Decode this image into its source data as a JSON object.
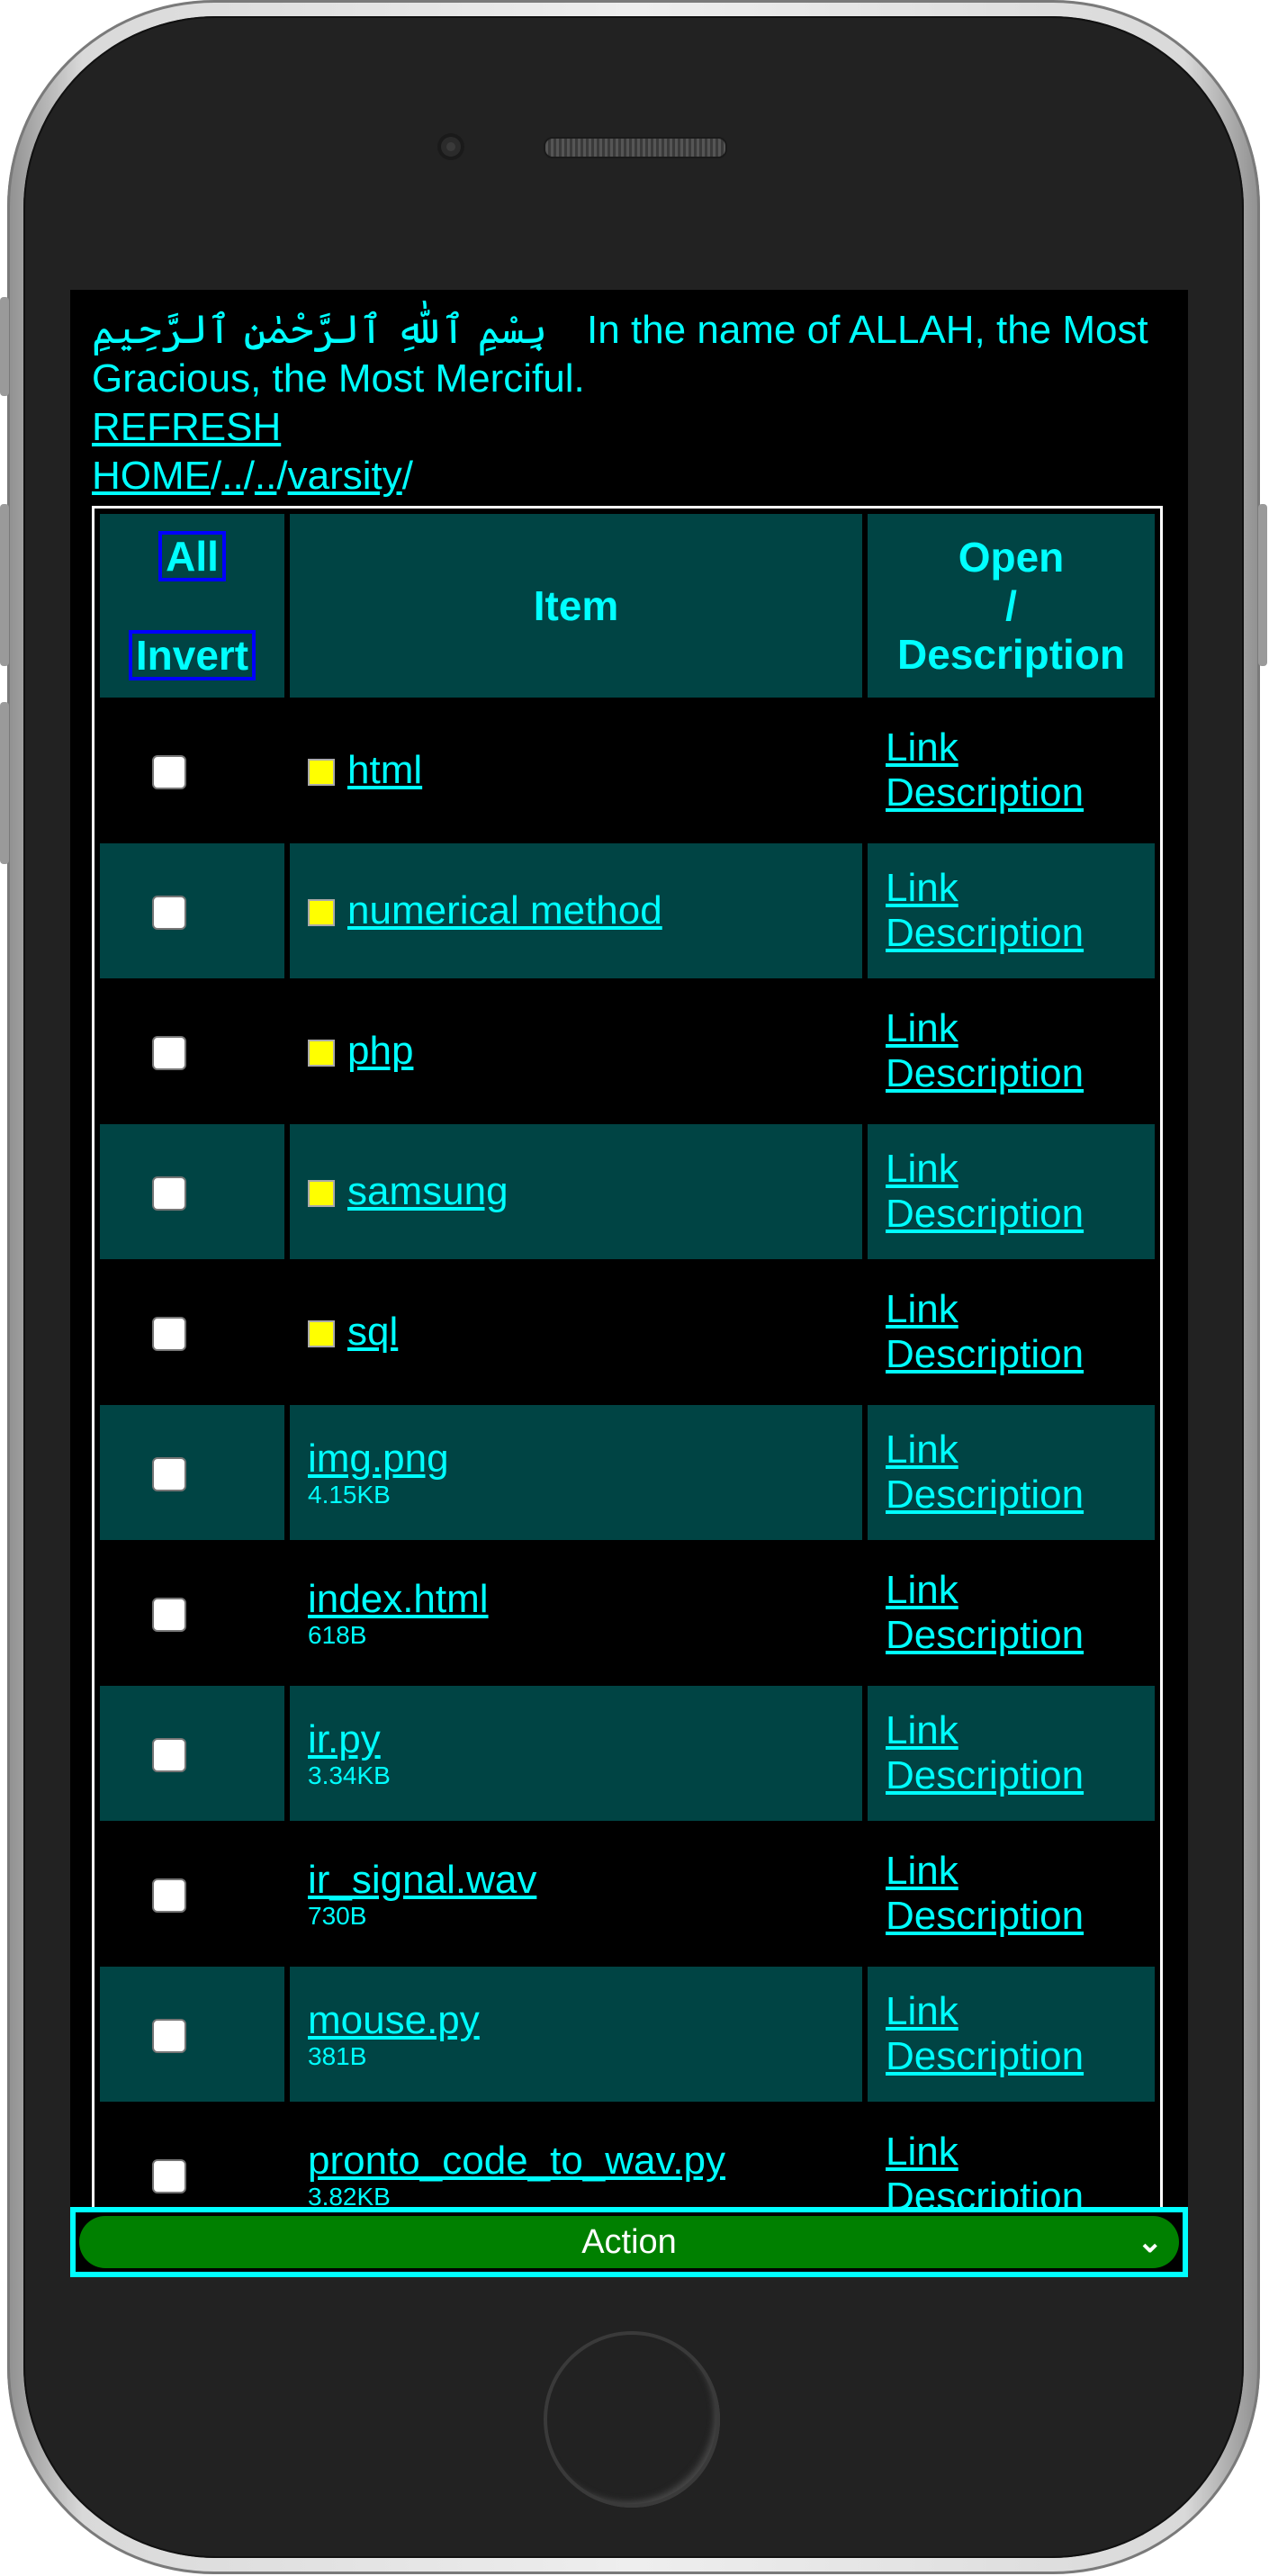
{
  "header": {
    "bismillah": "بِسْمِ ٱللّٰهِ ٱلرَّحْمٰنِ ٱلرَّحِيمِ",
    "translation": "In the name of ALLAH, the Most Gracious, the Most Merciful.",
    "refresh_label": "REFRESH",
    "breadcrumb": {
      "home": "HOME",
      "sep": "/",
      "up1": "..",
      "up2": "..",
      "folder": "varsity"
    }
  },
  "table": {
    "col_all": "All",
    "col_invert": "Invert",
    "col_item": "Item",
    "col_open_1": "Open",
    "col_open_2": "/",
    "col_open_3": "Description",
    "link_label": "Link",
    "desc_label": "Description",
    "rows": [
      {
        "name": "html",
        "size": "",
        "folder": true
      },
      {
        "name": "numerical method",
        "size": "",
        "folder": true
      },
      {
        "name": "php",
        "size": "",
        "folder": true
      },
      {
        "name": "samsung",
        "size": "",
        "folder": true
      },
      {
        "name": "sql",
        "size": "",
        "folder": true
      },
      {
        "name": "img.png",
        "size": "4.15KB",
        "folder": false
      },
      {
        "name": "index.html",
        "size": "618B",
        "folder": false
      },
      {
        "name": "ir.py",
        "size": "3.34KB",
        "folder": false
      },
      {
        "name": "ir_signal.wav",
        "size": "730B",
        "folder": false
      },
      {
        "name": "mouse.py",
        "size": "381B",
        "folder": false
      },
      {
        "name": "pronto_code_to_wav.py",
        "size": "3.82KB",
        "folder": false
      }
    ]
  },
  "action": {
    "label": "Action"
  },
  "colors": {
    "accent": "#00ffff",
    "teal_row": "#004444",
    "action_bg": "#008000",
    "folder_icon": "#ffff00"
  }
}
